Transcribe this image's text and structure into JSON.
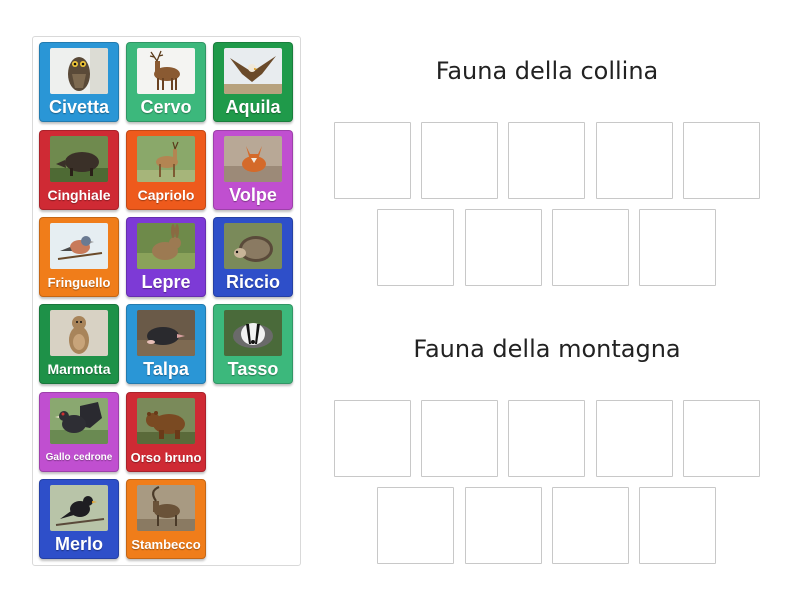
{
  "tiles": [
    {
      "label": "Civetta",
      "color": "#2a96d6",
      "icon": "owl-photo"
    },
    {
      "label": "Cervo",
      "color": "#3cb87c",
      "icon": "deer-photo"
    },
    {
      "label": "Aquila",
      "color": "#1f9a4a",
      "icon": "eagle-photo"
    },
    {
      "label": "Cinghiale",
      "color": "#cf2a34",
      "icon": "boar-photo"
    },
    {
      "label": "Capriolo",
      "color": "#ee5a1c",
      "icon": "roe-deer-photo"
    },
    {
      "label": "Volpe",
      "color": "#c04fd0",
      "icon": "fox-photo"
    },
    {
      "label": "Fringuello",
      "color": "#f07d1a",
      "icon": "finch-photo"
    },
    {
      "label": "Lepre",
      "color": "#7d3ad6",
      "icon": "hare-photo"
    },
    {
      "label": "Riccio",
      "color": "#2e4fc9",
      "icon": "hedgehog-photo"
    },
    {
      "label": "Marmotta",
      "color": "#1e9148",
      "icon": "marmot-photo"
    },
    {
      "label": "Talpa",
      "color": "#2a96d6",
      "icon": "mole-photo"
    },
    {
      "label": "Tasso",
      "color": "#3cb87c",
      "icon": "badger-photo"
    },
    {
      "label": "Gallo cedrone",
      "color": "#c04fd0",
      "icon": "capercaillie-photo"
    },
    {
      "label": "Orso bruno",
      "color": "#cf2a34",
      "icon": "bear-photo"
    },
    {
      "label": "Merlo",
      "color": "#2e4fc9",
      "icon": "blackbird-photo"
    },
    {
      "label": "Stambecco",
      "color": "#f07d1a",
      "icon": "ibex-photo"
    }
  ],
  "groups": [
    {
      "title": "Fauna della collina"
    },
    {
      "title": "Fauna della montagna"
    }
  ]
}
